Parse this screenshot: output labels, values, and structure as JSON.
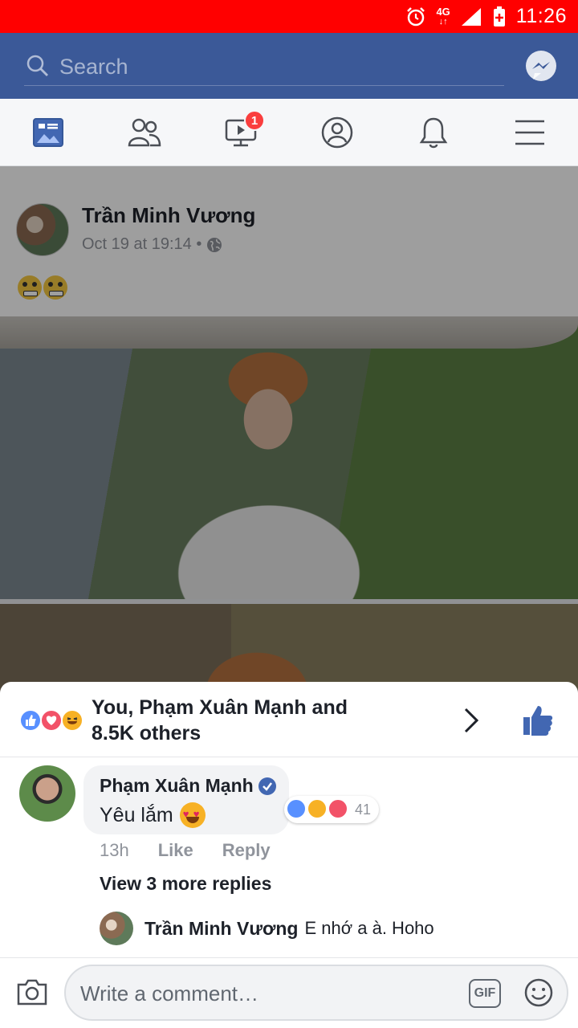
{
  "status_bar": {
    "time": "11:26",
    "network": "4G"
  },
  "header": {
    "search_placeholder": "Search"
  },
  "tabs": [
    {
      "name": "news-feed",
      "icon": "news-feed-icon"
    },
    {
      "name": "friends",
      "icon": "friends-icon"
    },
    {
      "name": "watch",
      "icon": "video-icon",
      "badge": "1"
    },
    {
      "name": "profile",
      "icon": "profile-icon"
    },
    {
      "name": "notifications",
      "icon": "bell-icon"
    },
    {
      "name": "menu",
      "icon": "menu-icon"
    }
  ],
  "post": {
    "author": "Trần Minh Vương",
    "timestamp": "Oct 19 at 19:14 •"
  },
  "reactions": {
    "summary_line1": "You, Phạm Xuân Mạnh and",
    "summary_line2": "8.5K others"
  },
  "comment": {
    "author": "Phạm Xuân Mạnh",
    "text": "Yêu lắm",
    "reaction_count": "41",
    "time": "13h",
    "like_label": "Like",
    "reply_label": "Reply",
    "view_more": "View 3 more replies"
  },
  "reply": {
    "author": "Trần Minh Vương",
    "text": "E nhớ a à. Hoho"
  },
  "composer": {
    "placeholder": "Write a comment…",
    "gif_label": "GIF"
  },
  "colors": {
    "status_bar": "#ff0000",
    "header": "#3b5998",
    "like_blue": "#4267b2",
    "love_red": "#f25268"
  }
}
